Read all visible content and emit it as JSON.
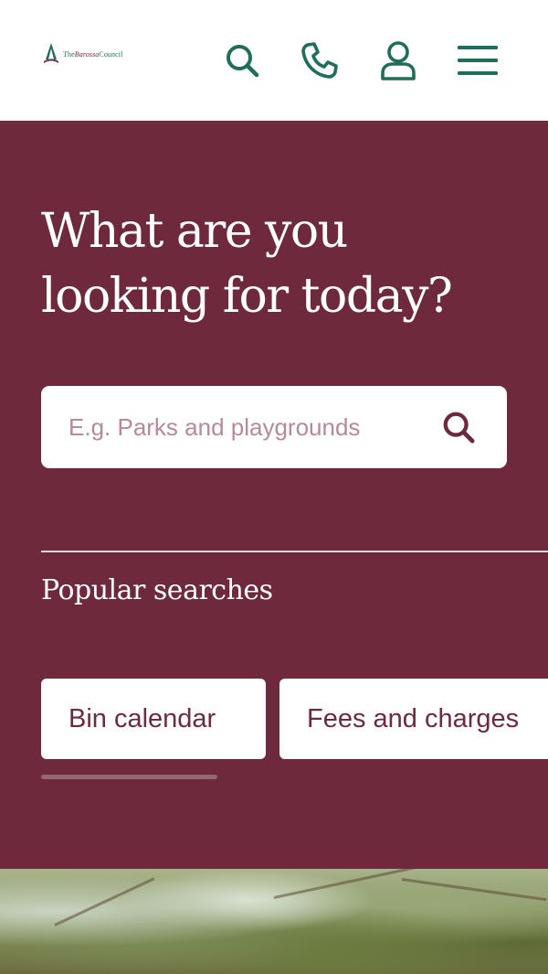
{
  "header": {
    "logo": {
      "prefix": "The",
      "accent": "Barossa",
      "suffix": "Council"
    },
    "icons": {
      "search": "search-icon",
      "phone": "phone-icon",
      "account": "user-icon",
      "menu": "hamburger-menu-icon"
    }
  },
  "hero": {
    "title_line1": "What are you",
    "title_line2": "looking for today?",
    "search": {
      "placeholder": "E.g. Parks and playgrounds",
      "value": "",
      "icon": "search-icon"
    },
    "popular_label": "Popular searches",
    "popular_searches": [
      "Bin calendar",
      "Fees and charges"
    ],
    "scroll_progress": 0.35
  },
  "colors": {
    "primary": "#6e2a3c",
    "accent_green": "#1e6e5a",
    "white": "#ffffff"
  }
}
